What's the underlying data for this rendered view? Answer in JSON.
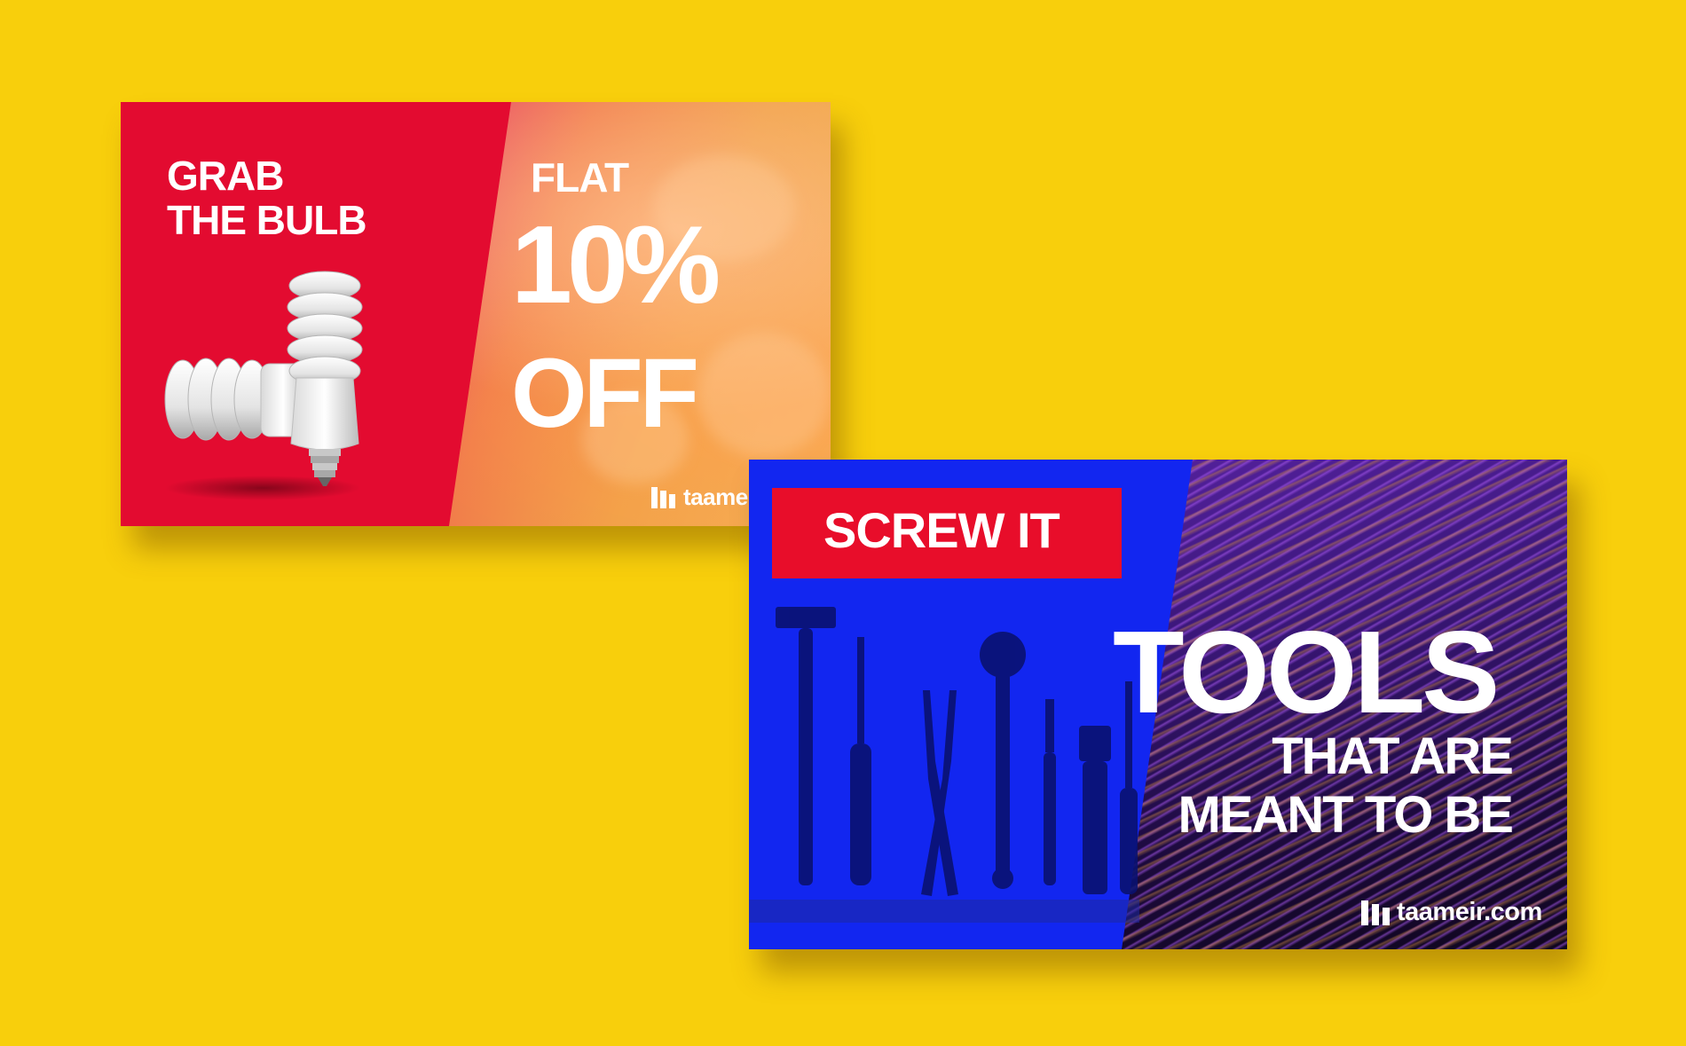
{
  "background_color": "#f8cf0c",
  "banners": [
    {
      "id": "bulb-banner",
      "headline_left": "GRAB\nTHE BULB",
      "offer_label": "FLAT",
      "offer_value": "10%",
      "offer_suffix": "OFF",
      "brand": "taameir.com",
      "left_color": "#e30b30",
      "gradient_colors": [
        "#8f12b8",
        "#e8426b",
        "#f0a247"
      ]
    },
    {
      "id": "tools-banner",
      "tag": "SCREW IT",
      "headline": "TOOLS",
      "subheadline": "THAT ARE\nMEANT TO BE",
      "brand": "taameir.com",
      "left_color": "#1226f0",
      "tag_color": "#e80d2a",
      "right_color": "#3b177a"
    }
  ]
}
